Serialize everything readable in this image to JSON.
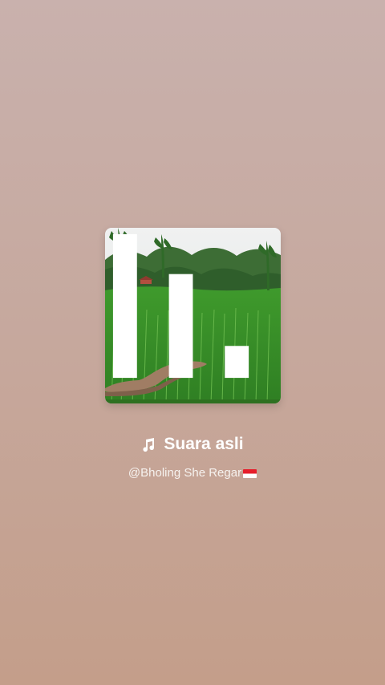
{
  "track": {
    "title": "Suara asli",
    "artist": "@Bholing She Regar"
  },
  "icons": {
    "title_icon": "music-note-icon",
    "cover_overlay_icon": "equalizer-bars-icon",
    "artist_suffix_icon": "indonesia-flag-icon"
  },
  "colors": {
    "text_primary": "#ffffff",
    "text_secondary": "#f6f2ef"
  }
}
